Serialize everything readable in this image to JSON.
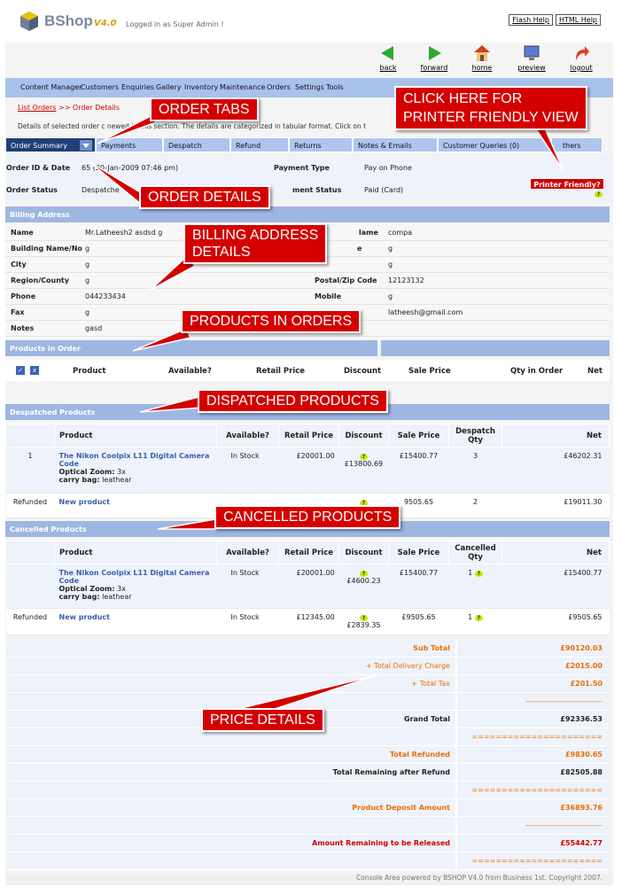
{
  "header": {
    "brand": "BShop",
    "version": "V4.0",
    "logged": "Logged in as Super Admin !",
    "flash_help": "Flash Help",
    "html_help": "HTML Help"
  },
  "nav_icons": [
    {
      "label": "back",
      "icon": "back-arrow-icon"
    },
    {
      "label": "forward",
      "icon": "forward-arrow-icon"
    },
    {
      "label": "home",
      "icon": "home-icon"
    },
    {
      "label": "preview",
      "icon": "monitor-icon"
    },
    {
      "label": "logout",
      "icon": "logout-icon"
    }
  ],
  "menu": [
    "Content Manager",
    "Customers",
    "Enquiries",
    "Gallery",
    "Inventory",
    "Maintenance",
    "Orders",
    "Settings",
    "Tools"
  ],
  "breadcrumb": {
    "link": "List Orders",
    "current": ">> Order Details"
  },
  "description": "Details of selected order c       newed in this section. The details are categorized in tabular format. Click on t",
  "tabs": [
    "Order Summary",
    "Payments",
    "Despatch",
    "Refund",
    "Returns",
    "Notes & Emails",
    "Customer Queries (0)",
    "thers"
  ],
  "order": {
    "id_label": "Order ID & Date",
    "id_value": "65  (20-Jan-2009 07:46 pm)",
    "status_label": "Order Status",
    "status_value": "Despatche",
    "pay_type_label": "Payment Type",
    "pay_type_value": "Pay on Phone",
    "pay_status_label": "ment Status",
    "pay_status_value": "Paid (Card)",
    "printer_friendly": "Printer Friendly?"
  },
  "billing": {
    "title": "Billing Address",
    "rows": [
      {
        "l": "Name",
        "v": "Mr.Latheesh2 asdsd g",
        "l2": "lame",
        "v2": "compa"
      },
      {
        "l": "Building Name/No",
        "v": "g",
        "l2": "e",
        "v2": "g"
      },
      {
        "l": "City",
        "v": "g",
        "l2": "",
        "v2": "g"
      },
      {
        "l": "Region/County",
        "v": "g",
        "l2": "Postal/Zip Code",
        "v2": "12123132"
      },
      {
        "l": "Phone",
        "v": "044233434",
        "l2": "Mobile",
        "v2": "g"
      },
      {
        "l": "Fax",
        "v": "g",
        "l2": "",
        "v2": "latheesh@gmail.com"
      },
      {
        "l": "Notes",
        "v": "gasd",
        "l2": "",
        "v2": ""
      }
    ]
  },
  "products_in_order": {
    "title": "Products in Order",
    "columns": [
      "Product",
      "Available?",
      "Retail Price",
      "Discount",
      "Sale Price",
      "Qty in Order",
      "Net"
    ]
  },
  "despatched": {
    "title": "Despatched Products",
    "columns": [
      "Product",
      "Available?",
      "Retail Price",
      "Discount",
      "Sale Price",
      "Despatch Qty",
      "Net"
    ],
    "rows": [
      {
        "idx": "1",
        "name": "The Nikon Coolpix L11 Digital Camera Code",
        "opt1": "Optical Zoom:",
        "opt1v": " 3x",
        "opt2": "carry bag:",
        "opt2v": " leathear",
        "avail": "In Stock",
        "retail": "£20001.00",
        "disc": "£13800.69",
        "sale": "£15400.77",
        "qty": "3",
        "net": "£46202.31"
      },
      {
        "idx": "Refunded",
        "name": "New product",
        "avail": "",
        "retail": "",
        "disc": "",
        "sale": "9505.65",
        "qty": "2",
        "net": "£19011.30"
      }
    ]
  },
  "cancelled": {
    "title": "Cancelled Products",
    "columns": [
      "Product",
      "Available?",
      "Retail Price",
      "Discount",
      "Sale Price",
      "Cancelled Qty",
      "Net"
    ],
    "rows": [
      {
        "idx": "",
        "name": "The Nikon Coolpix L11 Digital Camera Code",
        "opt1": "Optical Zoom:",
        "opt1v": " 3x",
        "opt2": "carry bag:",
        "opt2v": " leathear",
        "avail": "In Stock",
        "retail": "£20001.00",
        "disc": "£4600.23",
        "sale": "£15400.77",
        "qty": "1",
        "net": "£15400.77"
      },
      {
        "idx": "Refunded",
        "name": "New product",
        "avail": "In Stock",
        "retail": "£12345.00",
        "disc": "£2839.35",
        "sale": "£9505.65",
        "qty": "1",
        "net": "£9505.65"
      }
    ]
  },
  "price": {
    "sub_total": "Sub Total",
    "sub_total_v": "£90120.03",
    "delivery": "+ Total Delivery Charge",
    "delivery_v": "£2015.00",
    "tax": "+ Total Tax",
    "tax_v": "£201.50",
    "dash1": "------------------------------",
    "grand": "Grand Total",
    "grand_v": "£92336.53",
    "eq1": "======================",
    "refunded": "Total Refunded",
    "refunded_v": "£9830.65",
    "remaining": "Total Remaining after Refund",
    "remaining_v": "£82505.88",
    "eq2": "======================",
    "deposit": "Product Deposit Amount",
    "deposit_v": "£36893.76",
    "dash2": "------------------------------",
    "release": "Amount Remaining to be Released",
    "release_v": "£55442.77",
    "eq3": "======================"
  },
  "footer": "Console Area powered by BSHOP V4.0 from Business 1st. Copyright 2007.",
  "callouts": {
    "tabs": "ORDER TABS",
    "printer": "CLICK HERE FOR\nPRINTER FRIENDLY VIEW",
    "details": "ORDER DETAILS",
    "billing": "BILLING ADDRESS\nDETAILS",
    "products": "PRODUCTS IN ORDERS",
    "dispatched": "DISPATCHED PRODUCTS",
    "cancelled": "CANCELLED PRODUCTS",
    "price": "PRICE DETAILS"
  },
  "colors": {
    "callout": "#d40000",
    "menu": "#a9c2ea",
    "tab_active": "#1f3f78",
    "section": "#9db7e2",
    "orange": "#e97000"
  }
}
